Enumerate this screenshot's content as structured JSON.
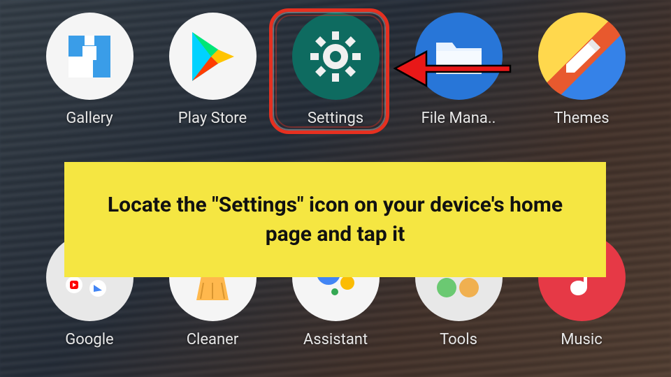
{
  "row1": [
    {
      "name": "gallery",
      "label": "Gallery"
    },
    {
      "name": "play-store",
      "label": "Play Store"
    },
    {
      "name": "settings",
      "label": "Settings"
    },
    {
      "name": "file-manager",
      "label": "File Mana.."
    },
    {
      "name": "themes",
      "label": "Themes"
    }
  ],
  "row2": [
    {
      "name": "google",
      "label": "Google"
    },
    {
      "name": "cleaner",
      "label": "Cleaner"
    },
    {
      "name": "assistant",
      "label": "Assistant"
    },
    {
      "name": "tools",
      "label": "Tools"
    },
    {
      "name": "music",
      "label": "Music"
    }
  ],
  "instruction": "Locate the \"Settings\" icon on your device's home page and tap it"
}
